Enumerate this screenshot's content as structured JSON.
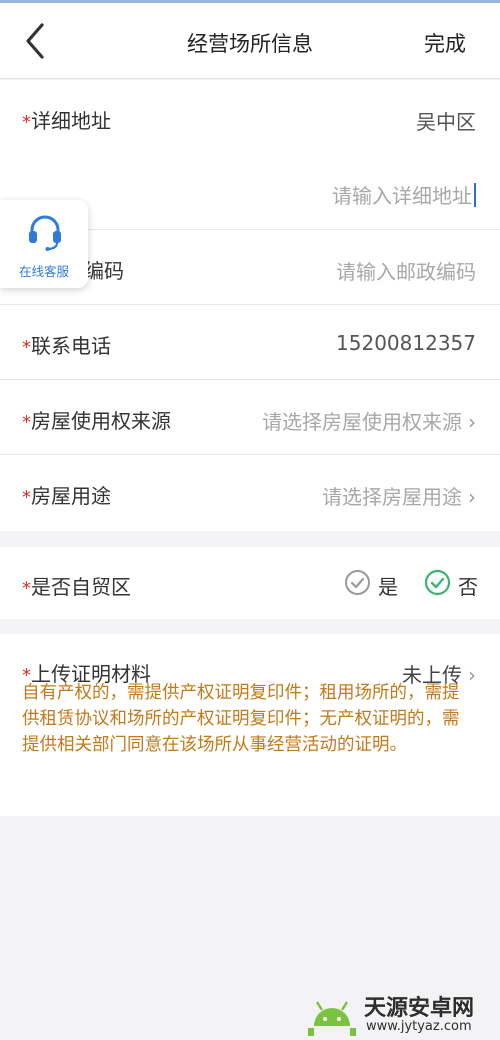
{
  "header": {
    "title": "经营场所信息",
    "done_label": "完成",
    "back_icon": "chevron-left-icon"
  },
  "form": {
    "address": {
      "required_mark": "*",
      "label": "详细地址",
      "district": "吴中区",
      "placeholder": "请输入详细地址"
    },
    "postal": {
      "label": "编码",
      "placeholder": "请输入邮政编码"
    },
    "phone": {
      "required_mark": "*",
      "label": "联系电话",
      "value": "15200812357"
    },
    "ownership_source": {
      "required_mark": "*",
      "label": "房屋使用权来源",
      "placeholder": "请选择房屋使用权来源"
    },
    "usage": {
      "required_mark": "*",
      "label": "房屋用途",
      "placeholder": "请选择房屋用途"
    },
    "free_trade_zone": {
      "required_mark": "*",
      "label": "是否自贸区",
      "options": [
        {
          "label": "是",
          "selected": false
        },
        {
          "label": "否",
          "selected": true
        }
      ],
      "selected_color": "#3cb371",
      "unselected_color": "#9a9a9a"
    },
    "upload": {
      "required_mark": "*",
      "label": "上传证明材料",
      "status": "未上传",
      "hint": "自有产权的，需提供产权证明复印件；租用场所的，需提供租赁协议和场所的产权证明复印件；无产权证明的，需提供相关部门同意在该场所从事经营活动的证明。",
      "hint_color": "#c27a1a"
    }
  },
  "service_widget": {
    "label": "在线客服",
    "icon": "headset-icon",
    "color": "#2f7bd6"
  },
  "watermark": {
    "name": "天源安卓网",
    "url": "www.jytyaz.com"
  },
  "colors": {
    "required": "#d93025",
    "placeholder": "#a8a8a8",
    "background": "#f3f3f5"
  }
}
